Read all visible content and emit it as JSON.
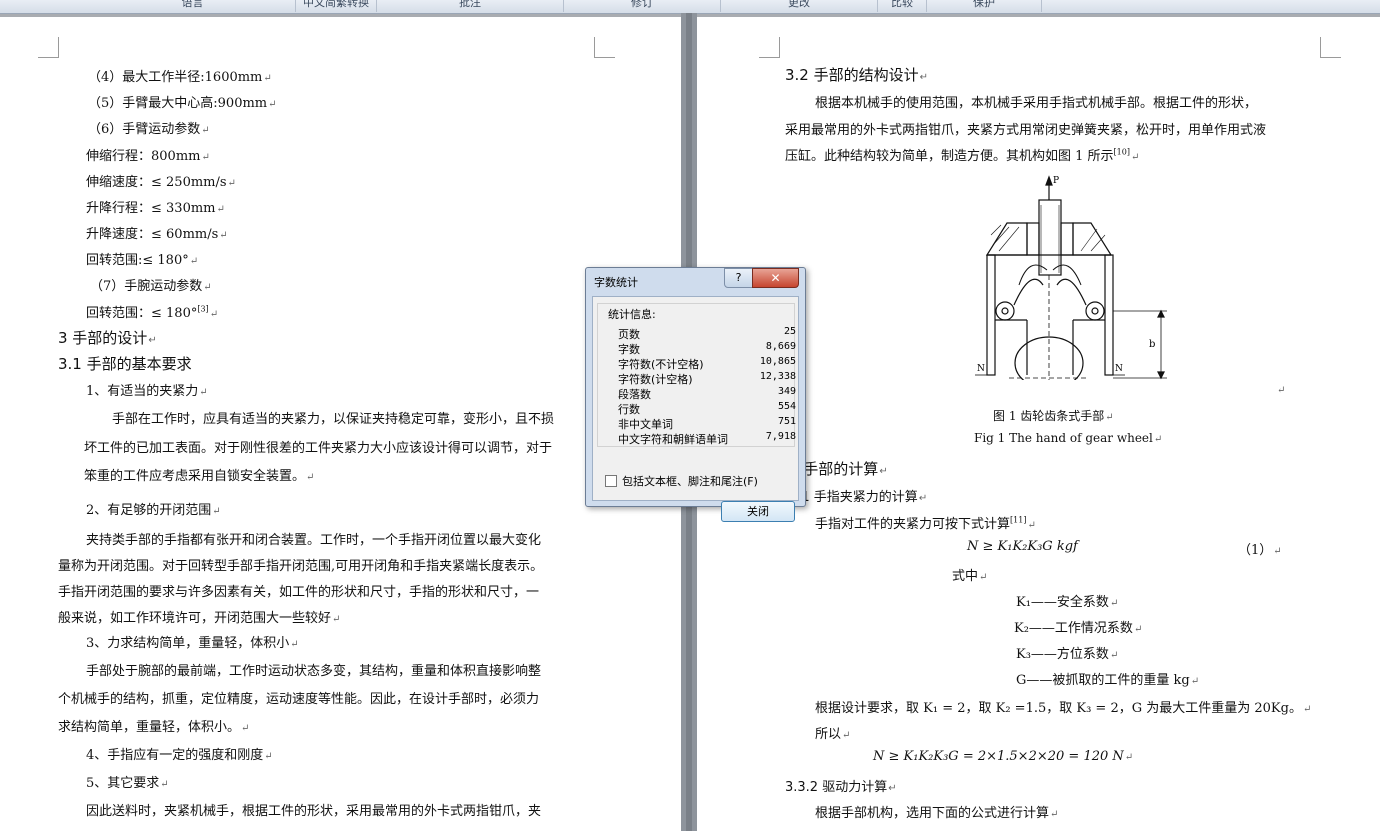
{
  "ribbon": {
    "groups": [
      "语言",
      "中文简繁转换",
      "批注",
      "修订",
      "更改",
      "比较",
      "保护"
    ]
  },
  "left_page": {
    "lines": [
      "（4）最大工作半径:1600mm",
      "（5）手臂最大中心高:900mm",
      "（6）手臂运动参数",
      "伸缩行程：800mm",
      "伸缩速度：≤ 250mm/s",
      "升降行程：≤ 330mm",
      "升降速度：≤ 60mm/s",
      "回转范围:≤ 180°",
      "（7）手腕运动参数",
      "回转范围：≤ 180°",
      "3  手部的设计",
      "3.1 手部的基本要求",
      "1、有适当的夹紧力",
      "手部在工作时，应具有适当的夹紧力，以保证夹持稳定可靠，变形小，且不损",
      "坏工件的已加工表面。对于刚性很差的工件夹紧力大小应该设计得可以调节，对于",
      "笨重的工件应考虑采用自锁安全装置。",
      "2、有足够的开闭范围",
      "夹持类手部的手指都有张开和闭合装置。工作时，一个手指开闭位置以最大变化",
      "量称为开闭范围。对于回转型手部手指开闭范围,可用开闭角和手指夹紧端长度表示。",
      "手指开闭范围的要求与许多因素有关，如工件的形状和尺寸，手指的形状和尺寸，一",
      "般来说，如工作环境许可，开闭范围大一些较好",
      "3、力求结构简单，重量轻，体积小",
      "手部处于腕部的最前端，工作时运动状态多变，其结构，重量和体积直接影响整",
      "个机械手的结构，抓重，定位精度，运动速度等性能。因此，在设计手部时，必须力",
      "求结构简单，重量轻，体积小。",
      "4、手指应有一定的强度和刚度",
      "5、其它要求",
      "因此送料时，夹紧机械手，根据工件的形状，采用最常用的外卡式两指钳爪，夹"
    ],
    "ref_3": "[3]"
  },
  "right_page": {
    "h32": "3.2  手部的结构设计",
    "p1": "根据本机械手的使用范围，本机械手采用手指式机械手部。根据工件的形状，",
    "p2": "采用最常用的外卡式两指钳爪，夹紧方式用常闭史弹簧夹紧，松开时，用单作用式液",
    "p3": "压缸。此种结构较为简单，制造方便。其机构如图 1 所示",
    "ref_10": "[10]",
    "fig_labels": {
      "P": "P",
      "b": "b",
      "N1": "N",
      "N2": "N"
    },
    "fig_cap_cn": "图 1 齿轮齿条式手部",
    "fig_cap_en": "Fig 1 The hand of gear wheel",
    "h33": "3  手部的计算",
    "h331": "3.1 手指夹紧力的计算",
    "p4": "手指对工件的夹紧力可按下式计算",
    "ref_11": "[11]",
    "formula1": "N ≥ K₁K₂K₃G   kgf",
    "eq_num": "（1）",
    "where": "式中",
    "defs": [
      "K₁——安全系数",
      "K₂——工作情况系数",
      "K₃——方位系数",
      "G——被抓取的工件的重量    kg"
    ],
    "p5": "根据设计要求，取 K₁ = 2，取 K₂ =1.5，取 K₃ = 2，G 为最大工件重量为 20Kg。",
    "p6": "所以",
    "formula2": "N ≥ K₁K₂K₃G = 2×1.5×2×20 = 120 N",
    "h332": "3.3.2 驱动力计算",
    "p7": "根据手部机构，选用下面的公式进行计算"
  },
  "dialog": {
    "title": "字数统计",
    "group_label": "统计信息:",
    "rows": [
      {
        "label": "页数",
        "value": "25"
      },
      {
        "label": "字数",
        "value": "8,669"
      },
      {
        "label": "字符数(不计空格)",
        "value": "10,865"
      },
      {
        "label": "字符数(计空格)",
        "value": "12,338"
      },
      {
        "label": "段落数",
        "value": "349"
      },
      {
        "label": "行数",
        "value": "554"
      },
      {
        "label": "非中文单词",
        "value": "751"
      },
      {
        "label": "中文字符和朝鲜语单词",
        "value": "7,918"
      }
    ],
    "checkbox_label": "包括文本框、脚注和尾注(F)",
    "close_button": "关闭",
    "help_glyph": "?",
    "close_glyph": "✕"
  }
}
